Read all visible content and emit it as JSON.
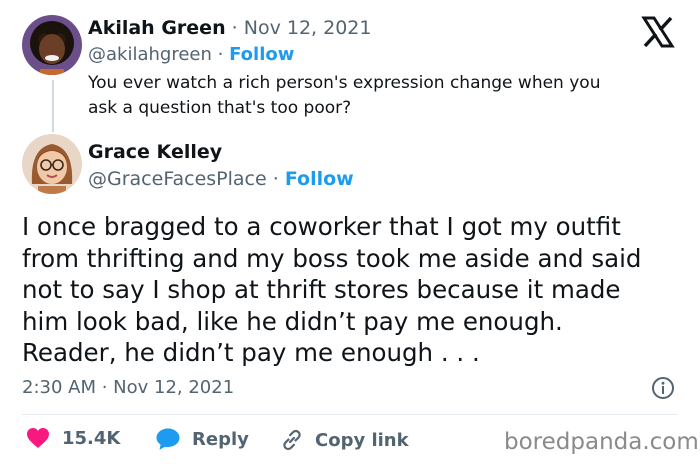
{
  "x_logo": "X",
  "quoted": {
    "name": "Akilah Green",
    "dot": "·",
    "date": "Nov 12, 2021",
    "handle": "@akilahgreen",
    "follow": "Follow",
    "text_line1": "You ever watch a rich person's expression change when you",
    "text_line2": "ask a question that's too poor?"
  },
  "reply": {
    "name": "Grace Kelley",
    "handle": "@GraceFacesPlace",
    "dot": "·",
    "follow": "Follow",
    "lines": [
      "I once bragged to a coworker that I got my outfit",
      "from thrifting and my boss took me aside and said",
      "not to say I shop at thrift stores because it made",
      "him look bad, like he didn’t pay me enough.",
      "Reader, he didn’t pay me enough . . ."
    ],
    "timestamp": "2:30 AM · Nov 12, 2021"
  },
  "actions": {
    "likes": "15.4K",
    "reply": "Reply",
    "copy_link": "Copy link"
  },
  "watermark": "boredpanda.com",
  "colors": {
    "heart": "#f91880",
    "blue": "#1d9bf0",
    "muted": "#536471"
  }
}
